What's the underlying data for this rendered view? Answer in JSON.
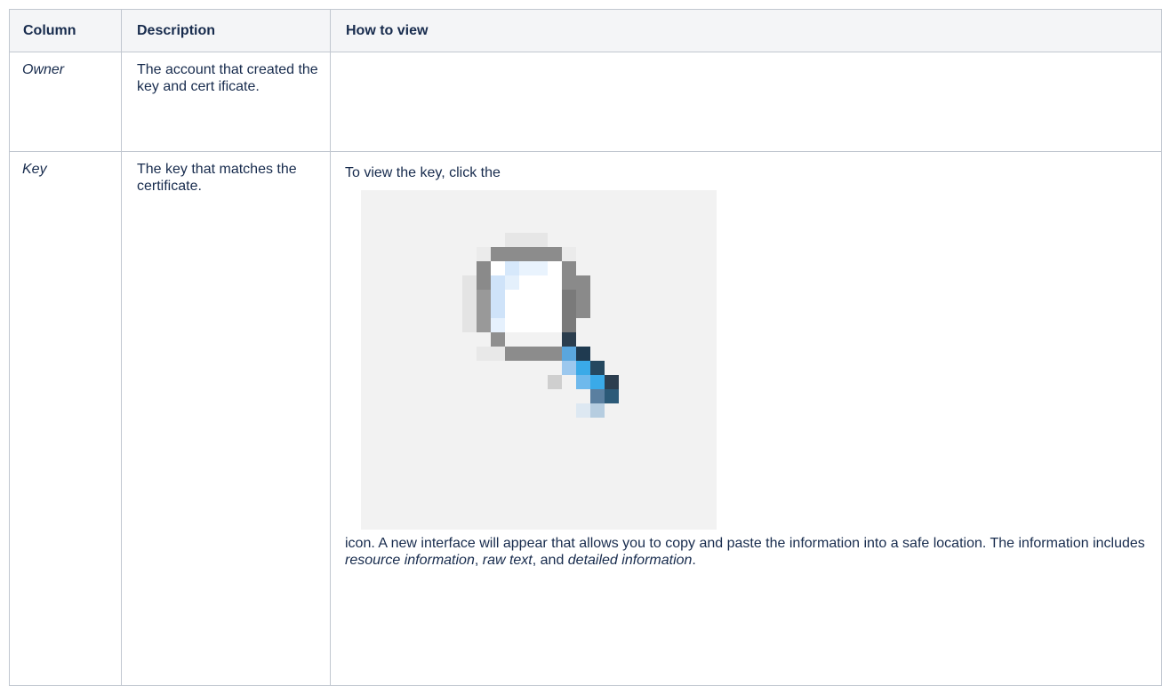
{
  "table": {
    "headers": [
      "Column",
      "Description",
      "How to view"
    ],
    "rows": [
      {
        "column": "Owner",
        "description": "The account that created the key and cert ificate.",
        "how_to_view": ""
      },
      {
        "column": "Key",
        "description": "The key that matches the certificate.",
        "how_to_view": {
          "before": "To view the key, click the",
          "icon": "magnifying-glass-icon",
          "after_1": "icon. A new interface will appear that allows you to copy and paste the information into a safe location. The information includes ",
          "em_1": "resource information",
          "sep_1": ", ",
          "em_2": "raw text",
          "sep_2": ", and ",
          "em_3": "detailed information",
          "end": "."
        }
      }
    ]
  },
  "colors": {
    "header_bg": "#f4f5f7",
    "border": "#c1c7d0",
    "icon_bg": "#f2f2f2",
    "accent": "#3aaae8"
  }
}
